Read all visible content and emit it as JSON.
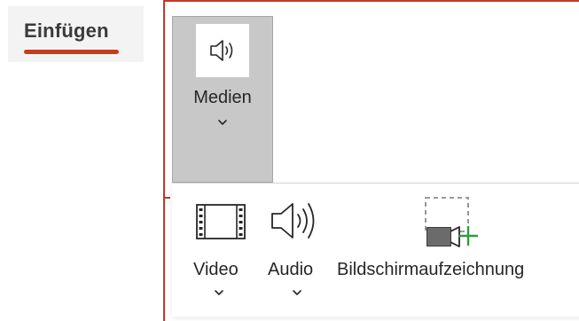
{
  "tab": {
    "label": "Einfügen",
    "accent_color": "#c43e1c"
  },
  "ribbon": {
    "frame_color": "#c0392b",
    "medien_button": {
      "label": "Medien",
      "icon": "speaker-icon",
      "state": "pressed",
      "has_dropdown": true
    }
  },
  "dropdown": {
    "items": [
      {
        "label": "Video",
        "icon": "film-strip-icon",
        "has_dropdown": true
      },
      {
        "label": "Audio",
        "icon": "speaker-icon",
        "has_dropdown": true
      },
      {
        "label": "Bildschirmaufzeichnung",
        "icon": "screen-recording-icon",
        "has_dropdown": false
      }
    ],
    "add_color": "#2e9c3f"
  }
}
